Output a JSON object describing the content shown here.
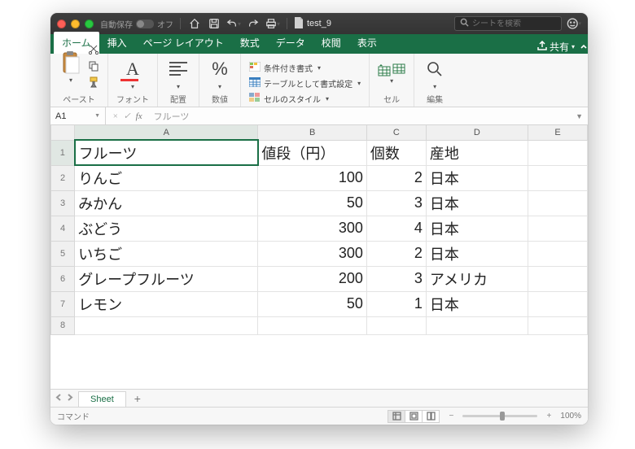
{
  "titlebar": {
    "autosave_label": "自動保存",
    "autosave_state": "オフ",
    "filename": "test_9",
    "search_placeholder": "シートを検索"
  },
  "tabs": {
    "home": "ホーム",
    "insert": "挿入",
    "page_layout": "ページ レイアウト",
    "formulas": "数式",
    "data": "データ",
    "review": "校閲",
    "view": "表示",
    "share": "共有"
  },
  "ribbon": {
    "paste": "ペースト",
    "font": "フォント",
    "alignment": "配置",
    "number": "数値",
    "cond_format": "条件付き書式",
    "table_format": "テーブルとして書式設定",
    "cell_styles": "セルのスタイル",
    "cells": "セル",
    "edit": "編集"
  },
  "formula_bar": {
    "cell_ref": "A1",
    "value": "フルーツ"
  },
  "columns": [
    "A",
    "B",
    "C",
    "D",
    "E"
  ],
  "rows": [
    {
      "n": "1",
      "a": "フルーツ",
      "b": "値段（円）",
      "c": "個数",
      "d": "産地",
      "b_align": "l",
      "c_align": "l"
    },
    {
      "n": "2",
      "a": "りんご",
      "b": "100",
      "c": "2",
      "d": "日本",
      "b_align": "r",
      "c_align": "r"
    },
    {
      "n": "3",
      "a": "みかん",
      "b": "50",
      "c": "3",
      "d": "日本",
      "b_align": "r",
      "c_align": "r"
    },
    {
      "n": "4",
      "a": "ぶどう",
      "b": "300",
      "c": "4",
      "d": "日本",
      "b_align": "r",
      "c_align": "r"
    },
    {
      "n": "5",
      "a": "いちご",
      "b": "300",
      "c": "2",
      "d": "日本",
      "b_align": "r",
      "c_align": "r"
    },
    {
      "n": "6",
      "a": "グレープフルーツ",
      "b": "200",
      "c": "3",
      "d": "アメリカ",
      "b_align": "r",
      "c_align": "r"
    },
    {
      "n": "7",
      "a": "レモン",
      "b": "50",
      "c": "1",
      "d": "日本",
      "b_align": "r",
      "c_align": "r"
    },
    {
      "n": "8",
      "a": "",
      "b": "",
      "c": "",
      "d": "",
      "b_align": "l",
      "c_align": "l"
    }
  ],
  "sheet_tab": "Sheet",
  "status": {
    "mode": "コマンド",
    "zoom": "100%"
  }
}
